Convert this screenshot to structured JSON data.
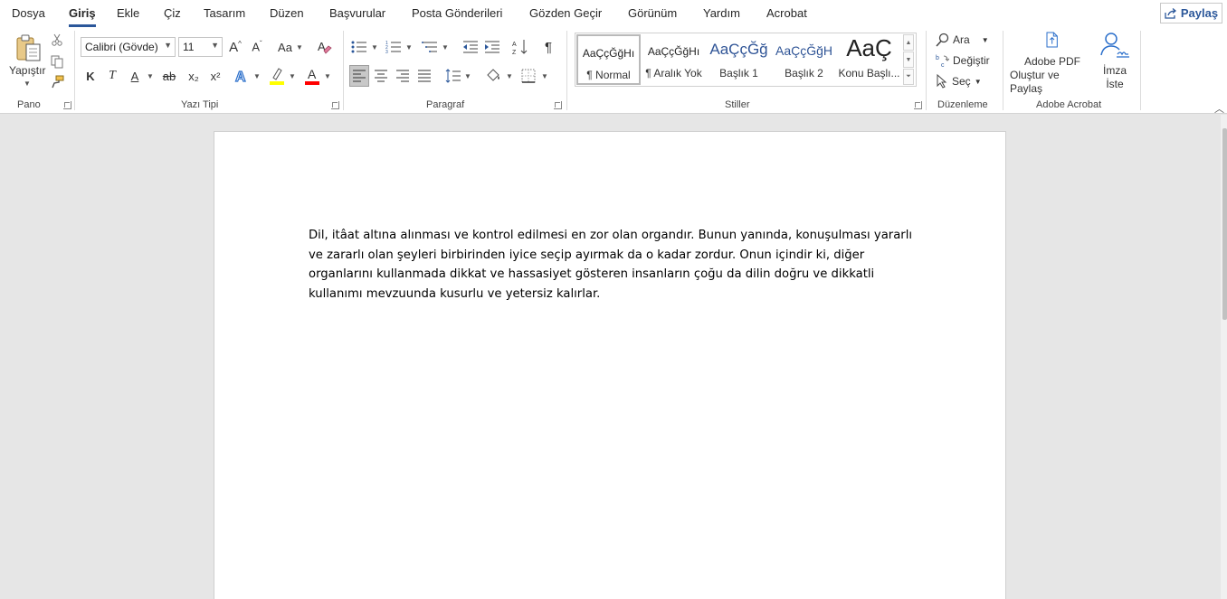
{
  "menu": {
    "tabs": [
      "Dosya",
      "Giriş",
      "Ekle",
      "Çiz",
      "Tasarım",
      "Düzen",
      "Başvurular",
      "Posta Gönderileri",
      "Gözden Geçir",
      "Görünüm",
      "Yardım",
      "Acrobat"
    ],
    "active_tab": "Giriş",
    "share_label": "Paylaş"
  },
  "ribbon": {
    "clipboard": {
      "paste_label": "Yapıştır",
      "group_label": "Pano"
    },
    "font": {
      "font_name": "Calibri (Gövde)",
      "font_size": "11",
      "change_case": "Aa",
      "bold": "K",
      "italic": "T",
      "underline": "A",
      "strike": "ab",
      "subscript": "x₂",
      "superscript": "x²",
      "group_label": "Yazı Tipi",
      "highlight_color": "#ffff00",
      "font_color": "#ff0000"
    },
    "paragraph": {
      "show_marks": "¶",
      "group_label": "Paragraf"
    },
    "styles": {
      "items": [
        {
          "preview": "AaÇçĞğHı",
          "name": "¶ Normal"
        },
        {
          "preview": "AaÇçĞğHı",
          "name": "¶ Aralık Yok"
        },
        {
          "preview": "AaÇçĞğ",
          "name": "Başlık 1"
        },
        {
          "preview": "AaÇçĞğH",
          "name": "Başlık 2"
        },
        {
          "preview": "AaÇ",
          "name": "Konu Başlı..."
        }
      ],
      "group_label": "Stiller"
    },
    "editing": {
      "find": "Ara",
      "replace": "Değiştir",
      "select": "Seç",
      "group_label": "Düzenleme"
    },
    "acrobat": {
      "create_pdf_line1": "Adobe PDF",
      "create_pdf_line2": "Oluştur ve Paylaş",
      "sign_line1": "İmza",
      "sign_line2": "İste",
      "group_label": "Adobe Acrobat"
    },
    "accent_color": "#2b579a"
  },
  "document": {
    "text": "Dil, itâat altına alınması ve kontrol edilmesi en zor olan organdır. Bunun yanında, konuşulması yararlı ve zararlı olan şeyleri birbirinden iyice seçip ayırmak da o kadar zordur. Onun içindir ki, diğer organlarını kullanmada dikkat ve hassasiyet gösteren insanların çoğu da dilin doğru ve dikkatli kullanımı mevzuunda kusurlu ve yetersiz kalırlar."
  }
}
